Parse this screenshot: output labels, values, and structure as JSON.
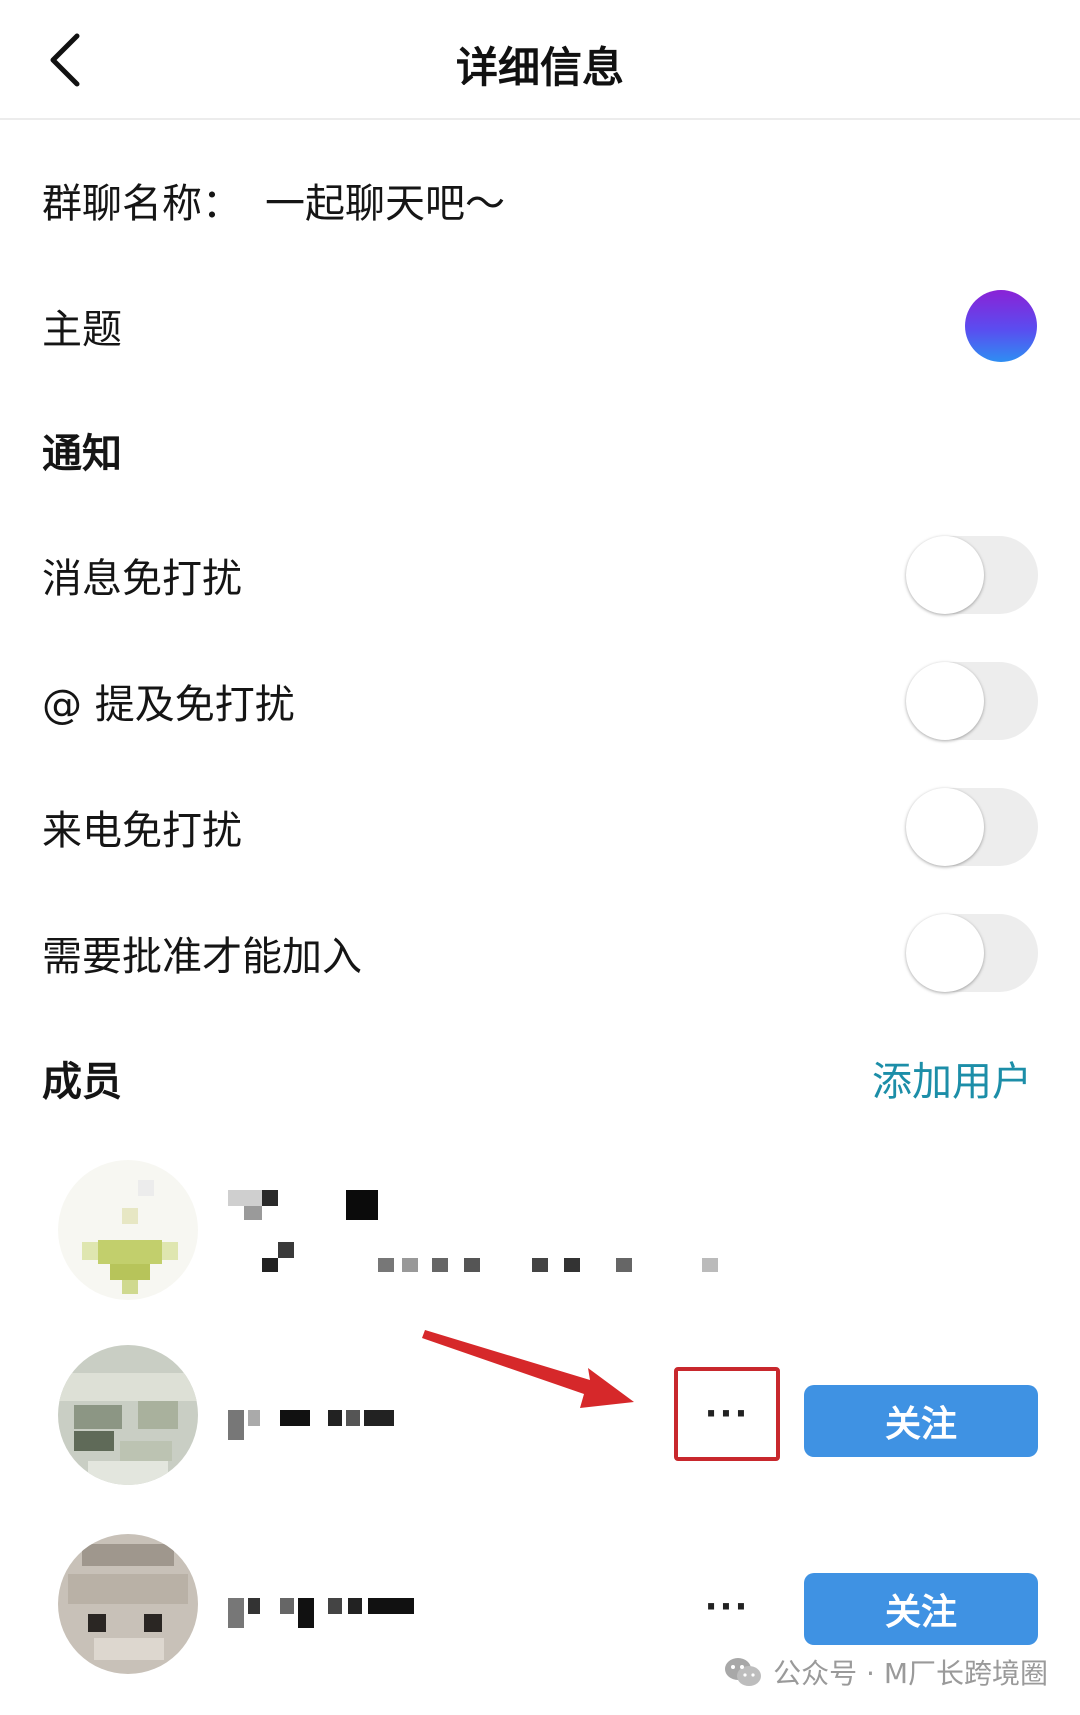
{
  "header": {
    "title": "详细信息",
    "back_icon": "chevron-left-icon"
  },
  "settings": {
    "group_name_label": "群聊名称：",
    "group_name_value": "一起聊天吧～",
    "theme_label": "主题",
    "theme_colors": [
      "#8a22d6",
      "#2e8ef2"
    ],
    "notifications_header": "通知",
    "toggles": [
      {
        "label": "消息免打扰",
        "on": false
      },
      {
        "label": "@ 提及免打扰",
        "on": false
      },
      {
        "label": "来电免打扰",
        "on": false
      },
      {
        "label": "需要批准才能加入",
        "on": false
      }
    ]
  },
  "members": {
    "header": "成员",
    "add_user_label": "添加用户",
    "list": [
      {
        "follow_label": null,
        "more_label": null
      },
      {
        "follow_label": "关注",
        "more_label": "···"
      },
      {
        "follow_label": "关注",
        "more_label": "···"
      }
    ]
  },
  "watermark": {
    "text": "公众号 · M厂长跨境圈",
    "icon": "wechat-icon"
  },
  "colors": {
    "accent": "#1c8ea8",
    "follow_button": "#3f92e3",
    "highlight": "#c8282d",
    "arrow": "#d6282a"
  }
}
